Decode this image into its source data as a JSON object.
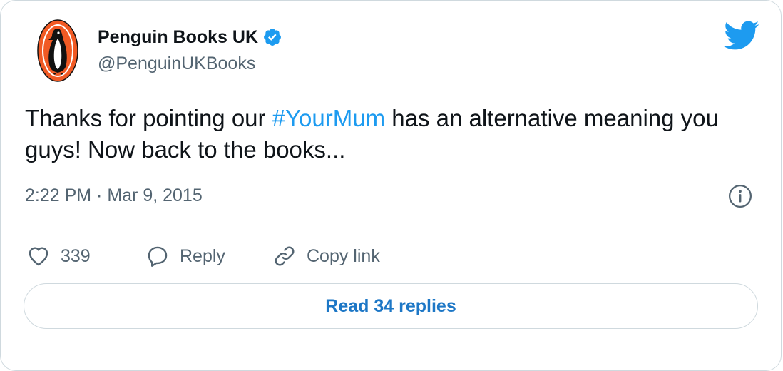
{
  "author": {
    "display_name": "Penguin Books UK",
    "handle": "@PenguinUKBooks",
    "verified": true,
    "avatar_icon": "penguin-logo-icon"
  },
  "tweet": {
    "text_before": "Thanks for pointing our ",
    "hashtag": "#YourMum",
    "text_after": " has an alternative meaning you guys! Now back to the books...",
    "timestamp": "2:22 PM · Mar 9, 2015"
  },
  "actions": {
    "like_count": "339",
    "reply_label": "Reply",
    "copy_link_label": "Copy link"
  },
  "footer": {
    "read_replies_label": "Read 34 replies"
  },
  "colors": {
    "accent": "#1d9bf0",
    "link_button": "#1d77c6",
    "text_primary": "#0f1419",
    "text_secondary": "#536471",
    "border": "#cfd9de",
    "penguin_orange": "#f15a24"
  }
}
